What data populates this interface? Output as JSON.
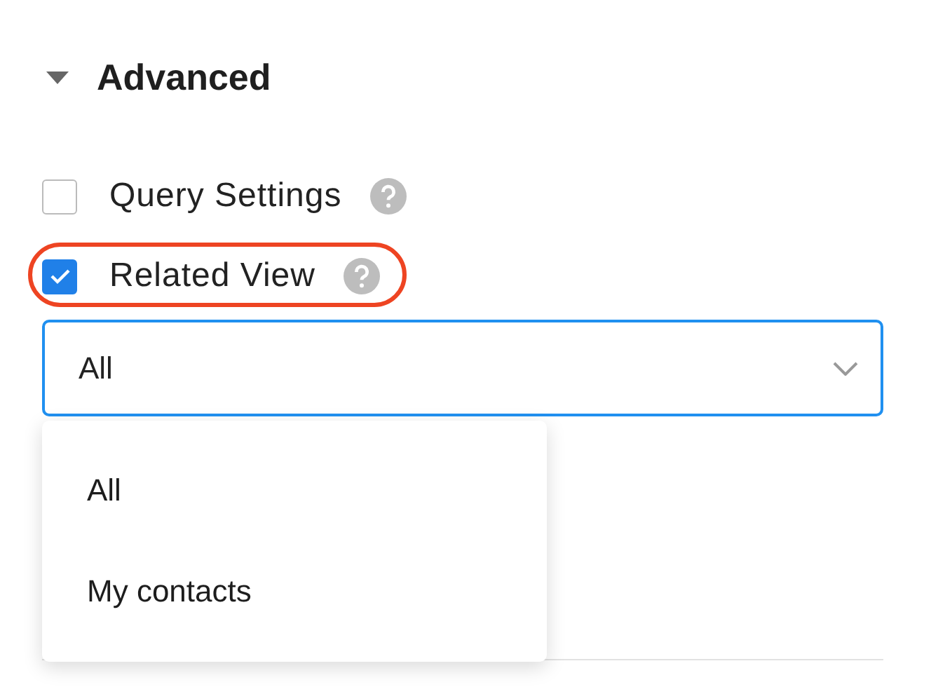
{
  "section": {
    "title": "Advanced",
    "expanded": true
  },
  "options": [
    {
      "label": "Query Settings",
      "checked": false,
      "highlighted": false
    },
    {
      "label": "Related View",
      "checked": true,
      "highlighted": true
    }
  ],
  "select": {
    "value": "All",
    "open": true
  },
  "menu": {
    "items": [
      "All",
      "My contacts"
    ]
  }
}
